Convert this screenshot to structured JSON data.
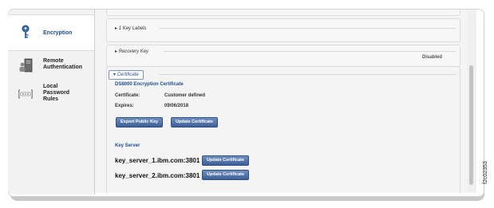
{
  "sidebar": {
    "items": [
      {
        "label": "Encryption",
        "active": true,
        "icon": "key-icon"
      },
      {
        "label": "Remote Authentication",
        "active": false,
        "icon": "server-user-icon"
      },
      {
        "label": "Local Password Rules",
        "active": false,
        "icon": "password-field-icon"
      }
    ]
  },
  "main": {
    "key_labels": {
      "title": "1 Key Labels"
    },
    "recovery_key": {
      "title": "Recovery Key",
      "status": "Disabled"
    },
    "certificate": {
      "tag": "Certificate",
      "title": "DS8000 Encryption Certificate",
      "certificate_label": "Certificate:",
      "certificate_value": "Customer defined",
      "expires_label": "Expires:",
      "expires_value": "09/06/2018",
      "export_button": "Export Public Key",
      "update_button": "Update Certificate"
    },
    "key_server": {
      "title": "Key Server",
      "servers": [
        {
          "name": "key_server_1.ibm.com:3801",
          "button": "Update Certificate"
        },
        {
          "name": "key_server_2.ibm.com:3801",
          "button": "Update Certificate"
        }
      ]
    }
  },
  "figure_id": "f2c02353",
  "colors": {
    "accent": "#1f4f8f",
    "button": "#4a6ba3"
  }
}
